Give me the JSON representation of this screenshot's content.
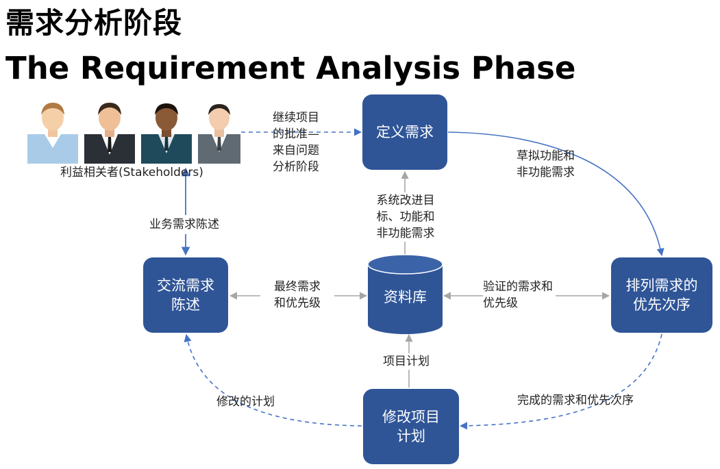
{
  "title": {
    "cn": "需求分析阶段",
    "en": "The Requirement Analysis Phase"
  },
  "stakeholders": {
    "label": "利益相关者(Stakeholders)",
    "icons": [
      "person-icon",
      "person-tie-icon",
      "person-tie-icon",
      "person-tie-icon"
    ]
  },
  "boxes": {
    "define": "定义需求",
    "prioritize": "排列需求的\n优先次序",
    "communicate": "交流需求\n陈述",
    "revise_plan": "修改项目\n计划"
  },
  "database": "资料库",
  "edge_labels": {
    "approval": "继续项目\n的批准—\n来自问题\n分析阶段",
    "draft": "草拟功能和\n非功能需求",
    "improve": "系统改进目\n标、功能和\n非功能需求",
    "business": "业务需求陈述",
    "final": "最终需求\n和优先级",
    "verified": "验证的需求和\n优先级",
    "plan": "项目计划",
    "completed": "完成的需求和优先次序",
    "revised": "修改的计划"
  },
  "colors": {
    "box": "#2f5597",
    "arrow_blue": "#4472c4",
    "arrow_gray": "#a6a6a6"
  }
}
